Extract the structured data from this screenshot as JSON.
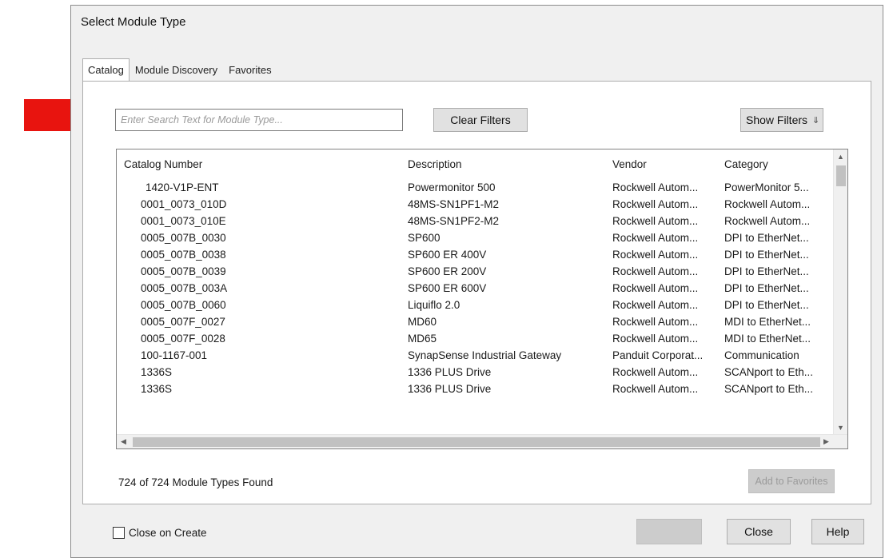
{
  "dialog": {
    "title": "Select Module Type"
  },
  "tabs": [
    {
      "label": "Catalog",
      "active": true
    },
    {
      "label": "Module Discovery",
      "active": false
    },
    {
      "label": "Favorites",
      "active": false
    }
  ],
  "search": {
    "placeholder": "Enter Search Text for Module Type...",
    "value": ""
  },
  "buttons": {
    "clear_filters": "Clear Filters",
    "show_filters": "Show Filters",
    "add_to_favorites": "Add to Favorites",
    "create": "",
    "close": "Close",
    "help": "Help"
  },
  "icons": {
    "show_filters": "chevron-double-down-icon",
    "annotation": "red-arrow-icon"
  },
  "colors": {
    "annotation_arrow": "#e8140f"
  },
  "table": {
    "headers": [
      "Catalog Number",
      "Description",
      "Vendor",
      "Category"
    ],
    "rows": [
      [
        "1420-V1P-ENT",
        "Powermonitor 500",
        "Rockwell Autom...",
        "PowerMonitor 5..."
      ],
      [
        "0001_0073_010D",
        "48MS-SN1PF1-M2",
        "Rockwell Autom...",
        "Rockwell Autom..."
      ],
      [
        "0001_0073_010E",
        "48MS-SN1PF2-M2",
        "Rockwell Autom...",
        "Rockwell Autom..."
      ],
      [
        "0005_007B_0030",
        "SP600",
        "Rockwell Autom...",
        "DPI to EtherNet..."
      ],
      [
        "0005_007B_0038",
        "SP600 ER 400V",
        "Rockwell Autom...",
        "DPI to EtherNet..."
      ],
      [
        "0005_007B_0039",
        "SP600 ER 200V",
        "Rockwell Autom...",
        "DPI to EtherNet..."
      ],
      [
        "0005_007B_003A",
        "SP600 ER 600V",
        "Rockwell Autom...",
        "DPI to EtherNet..."
      ],
      [
        "0005_007B_0060",
        "Liquiflo 2.0",
        "Rockwell Autom...",
        "DPI to EtherNet..."
      ],
      [
        "0005_007F_0027",
        "MD60",
        "Rockwell Autom...",
        "MDI to EtherNet..."
      ],
      [
        "0005_007F_0028",
        "MD65",
        "Rockwell Autom...",
        "MDI to EtherNet..."
      ],
      [
        "100-1167-001",
        "SynapSense Industrial Gateway",
        "Panduit Corporat...",
        "Communication"
      ],
      [
        "1336S",
        "1336 PLUS Drive",
        "Rockwell Autom...",
        "SCANport to Eth..."
      ],
      [
        "1336S",
        "1336 PLUS Drive",
        "Rockwell Autom...",
        "SCANport to Eth..."
      ]
    ]
  },
  "status": {
    "found_text": "724 of 724 Module Types Found"
  },
  "options": {
    "close_on_create_label": "Close on Create",
    "close_on_create_checked": false
  }
}
